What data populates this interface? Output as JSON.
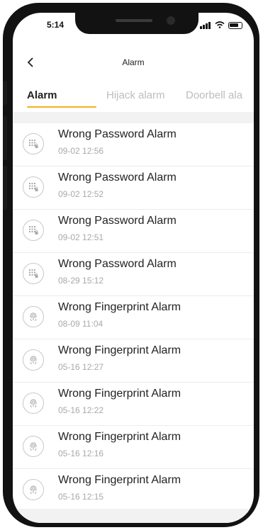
{
  "status_bar": {
    "time": "5:14"
  },
  "header": {
    "title": "Alarm"
  },
  "tabs": [
    {
      "label": "Alarm",
      "active": true
    },
    {
      "label": "Hijack alarm",
      "active": false
    },
    {
      "label": "Doorbell ala",
      "active": false
    }
  ],
  "alarms": [
    {
      "title": "Wrong Password Alarm",
      "time": "09-02 12:56",
      "icon": "keypad-lock-icon"
    },
    {
      "title": "Wrong Password Alarm",
      "time": "09-02 12:52",
      "icon": "keypad-lock-icon"
    },
    {
      "title": "Wrong Password Alarm",
      "time": "09-02 12:51",
      "icon": "keypad-lock-icon"
    },
    {
      "title": "Wrong Password Alarm",
      "time": "08-29 15:12",
      "icon": "keypad-lock-icon"
    },
    {
      "title": "Wrong Fingerprint Alarm",
      "time": "08-09 11:04",
      "icon": "fingerprint-icon"
    },
    {
      "title": "Wrong Fingerprint Alarm",
      "time": "05-16 12:27",
      "icon": "fingerprint-icon"
    },
    {
      "title": "Wrong Fingerprint Alarm",
      "time": "05-16 12:22",
      "icon": "fingerprint-icon"
    },
    {
      "title": "Wrong Fingerprint Alarm",
      "time": "05-16 12:16",
      "icon": "fingerprint-icon"
    },
    {
      "title": "Wrong Fingerprint Alarm",
      "time": "05-16 12:15",
      "icon": "fingerprint-icon"
    }
  ],
  "colors": {
    "accent": "#f5b21f",
    "tab_inactive": "#bdbdbd",
    "text": "#222222",
    "subtext": "#a9a9a9"
  }
}
